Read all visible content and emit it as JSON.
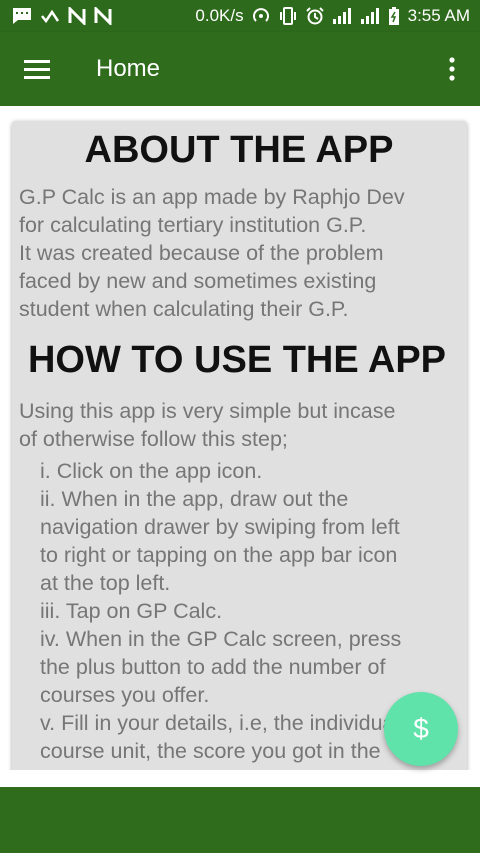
{
  "status_bar": {
    "network_speed": "0.0K/s",
    "time": "3:55 AM",
    "left_icons": [
      "message-icon",
      "check-wave-icon",
      "n-icon",
      "n-icon"
    ],
    "right_icons": [
      "hotspot-icon",
      "vibrate-icon",
      "alarm-icon",
      "signal-icon",
      "signal-icon",
      "battery-icon"
    ]
  },
  "app_bar": {
    "title": "Home",
    "menu_icon": "hamburger-menu-icon",
    "overflow_icon": "more-vert-icon",
    "color": "#2f6d1d"
  },
  "content": {
    "about_heading": "ABOUT THE APP",
    "about_text": "G.P Calc is an app made by Raphjo Dev\nfor calculating tertiary institution G.P.\nIt was created because of the problem\nfaced by new and sometimes existing\nstudent when calculating their G.P.",
    "howto_heading": "HOW TO USE THE APP",
    "howto_intro": "Using this app is very simple but incase\nof otherwise follow this step;",
    "steps": [
      "i. Click on the app icon.",
      "ii. When in the app, draw out the\nnavigation drawer by swiping from left\nto right or tapping on the app bar icon\nat the top left.",
      "iii. Tap on GP Calc.",
      "iv. When in the GP Calc screen, press\nthe plus button to add the number of\ncourses you offer.",
      "v. Fill in your details, i.e, the individual\ncourse unit, the score you got in the"
    ]
  },
  "fab": {
    "label": "$",
    "icon": "dollar-icon",
    "color": "#5fe3ab"
  }
}
